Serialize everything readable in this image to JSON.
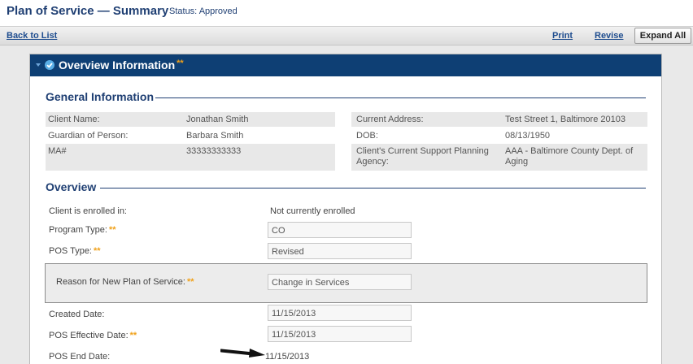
{
  "header": {
    "title": "Plan of Service — Summary",
    "status": "Status: Approved"
  },
  "toolbar": {
    "back_label": "Back to List",
    "print_label": "Print",
    "revise_label": "Revise",
    "expand_label": "Expand All"
  },
  "panel": {
    "title": "Overview Information",
    "required_marker": "**"
  },
  "general": {
    "title": "General Information",
    "client_name_label": "Client Name:",
    "client_name": "Jonathan Smith",
    "guardian_label": "Guardian of Person:",
    "guardian": "Barbara Smith",
    "ma_label": "MA#",
    "ma": "33333333333",
    "address_label": "Current Address:",
    "address": "Test Street 1, Baltimore 20103",
    "dob_label": "DOB:",
    "dob": "08/13/1950",
    "agency_label": "Client's Current Support Planning Agency:",
    "agency": "AAA - Baltimore County Dept. of Aging"
  },
  "overview": {
    "title": "Overview",
    "enrolled_label": "Client is enrolled in:",
    "enrolled_value": "Not currently enrolled",
    "program_type_label": "Program Type:",
    "program_type_value": "CO",
    "pos_type_label": "POS Type:",
    "pos_type_value": "Revised",
    "reason_label": "Reason for New Plan of Service:",
    "reason_value": "Change in Services",
    "created_label": "Created Date:",
    "created_value": "11/15/2013",
    "effective_label": "POS Effective Date:",
    "effective_value": "11/15/2013",
    "end_label": "POS End Date:",
    "end_value": "11/15/2013"
  },
  "colors": {
    "header_bg": "#0e3f74",
    "title_text": "#1f3f73",
    "required_star": "#f0a11a"
  },
  "icons": [
    "caret-down-icon",
    "check-circle-icon",
    "arrow-right-icon"
  ]
}
